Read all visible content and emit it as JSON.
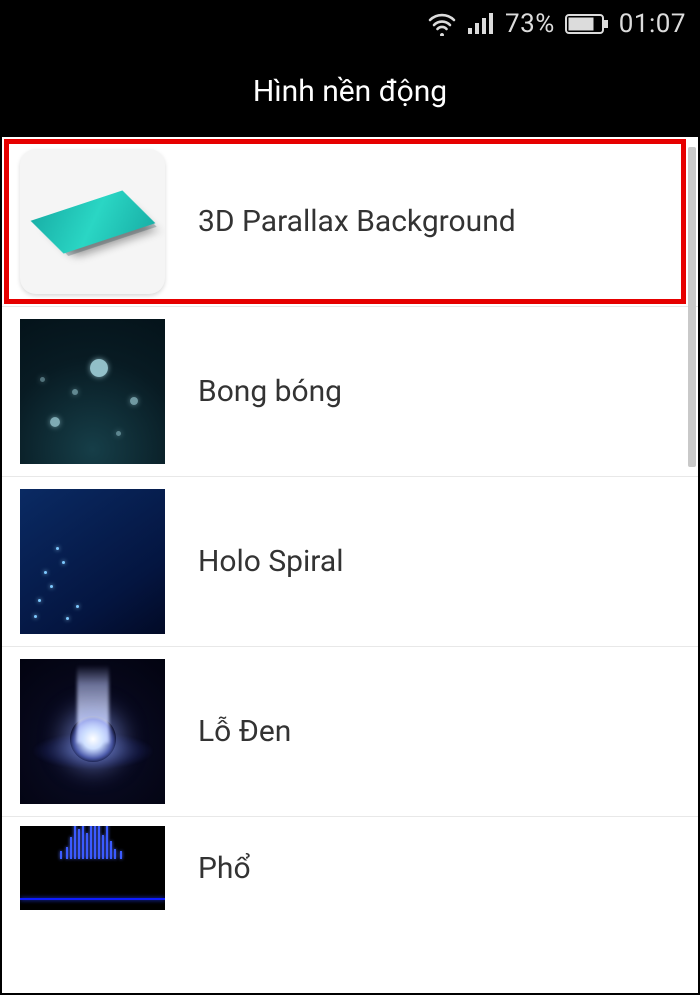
{
  "status": {
    "battery_percent": "73%",
    "clock": "01:07"
  },
  "header": {
    "title": "Hình nền động"
  },
  "wallpapers": [
    {
      "name": "3D Parallax Background",
      "highlighted": true
    },
    {
      "name": "Bong bóng",
      "highlighted": false
    },
    {
      "name": "Holo Spiral",
      "highlighted": false
    },
    {
      "name": "Lỗ Đen",
      "highlighted": false
    },
    {
      "name": "Phổ",
      "highlighted": false
    }
  ]
}
